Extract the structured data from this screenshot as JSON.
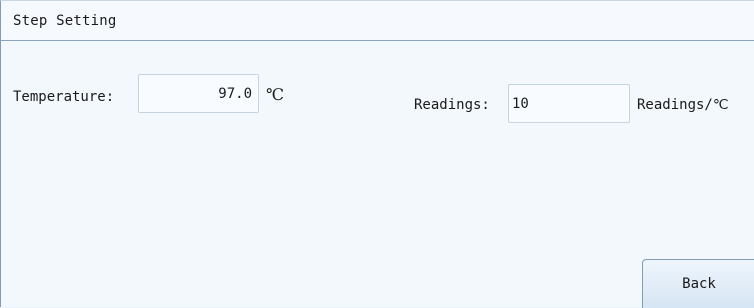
{
  "window": {
    "title": "Step Setting"
  },
  "temperature": {
    "label": "Temperature:",
    "value": "97.0",
    "unit": "℃"
  },
  "readings": {
    "label": "Readings:",
    "value": "10",
    "unit": "Readings/℃"
  },
  "actions": {
    "back_label": "Back"
  },
  "colors": {
    "background": "#f3f8fd",
    "border": "#7f9db9",
    "field_border": "#c6d3e2"
  }
}
